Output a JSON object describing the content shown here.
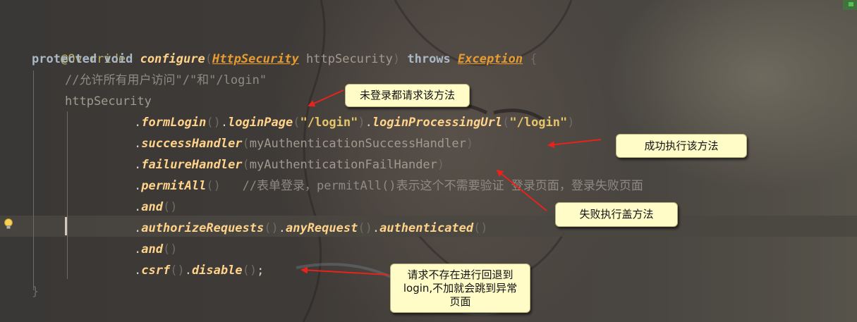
{
  "code": {
    "annotation": "@Override",
    "signature": {
      "protected": "protected",
      "void": "void",
      "method": "configure",
      "open_paren": "(",
      "param_type": "HttpSecurity",
      "param_name": "httpSecurity",
      "close_paren": ")",
      "throws": "throws",
      "exception": "Exception",
      "brace": "{"
    },
    "comment_line": "//允许所有用户访问\"/\"和\"/login\"",
    "receiver": "httpSecurity",
    "chain": {
      "form_login": "formLogin",
      "login_page": "loginPage",
      "login_page_arg": "\"/login\"",
      "login_processing_url": "loginProcessingUrl",
      "login_processing_url_arg": "\"/login\"",
      "success_handler": "successHandler",
      "success_handler_arg": "myAuthenticationSuccessHandler",
      "failure_handler": "failureHandler",
      "failure_handler_arg": "myAuthenticationFailHander",
      "permit_all": "permitAll",
      "permit_all_comment": "//表单登录，permitAll()表示这个不需要验证 登录页面，登录失败页面",
      "and1": "and",
      "authorize_requests": "authorizeRequests",
      "any_request": "anyRequest",
      "authenticated": "authenticated",
      "and2": "and",
      "csrf": "csrf",
      "disable": "disable",
      "semicolon": ";"
    },
    "closing_brace": "}"
  },
  "callouts": {
    "not_logged_in": "未登录都请求该方法",
    "success": "成功执行该方法",
    "failure": "失败执行盖方法",
    "csrf_line1": "请求不存在进行回退到",
    "csrf_line2": "login,不加就会跳到异常",
    "csrf_line3": "页面"
  },
  "icons": {
    "gutter": "lightbulb-icon"
  },
  "colors": {
    "keyword": "#cc7832",
    "method": "#ffc66d",
    "string": "#e6c56a",
    "callout_bg": "#fffcc8",
    "arrow": "#e8221c"
  }
}
